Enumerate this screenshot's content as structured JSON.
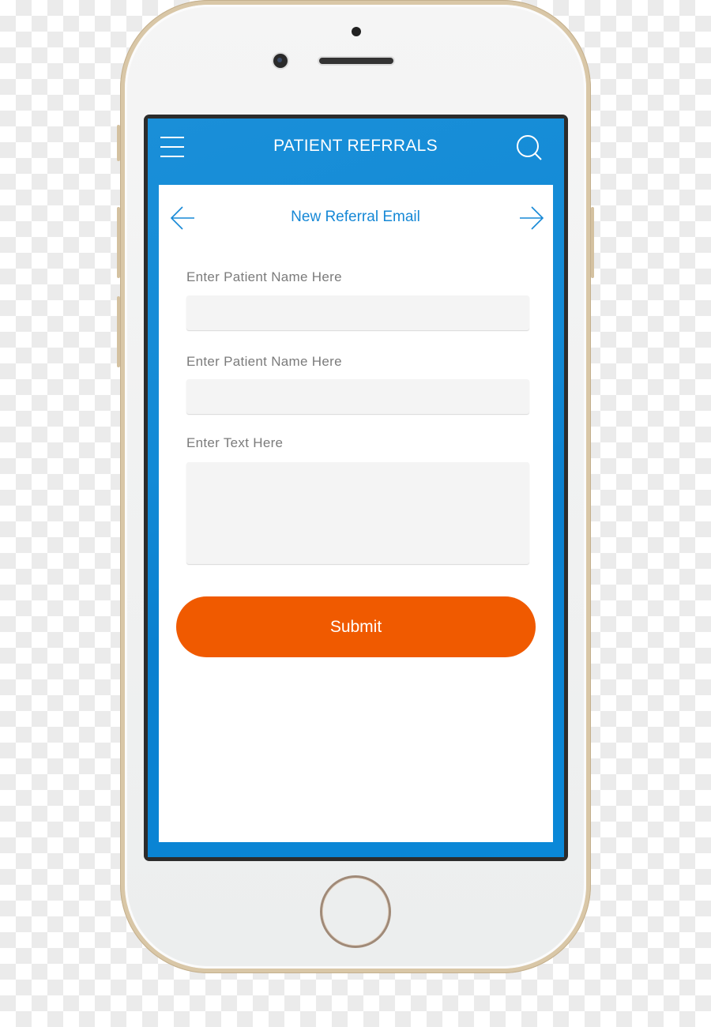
{
  "header": {
    "title": "PATIENT REFRRALS",
    "menu_icon": "hamburger-icon",
    "search_icon": "search-icon"
  },
  "subheader": {
    "title": "New Referral Email",
    "back_icon": "arrow-left-icon",
    "forward_icon": "arrow-right-icon"
  },
  "form": {
    "fields": [
      {
        "label": "Enter Patient Name Here",
        "value": ""
      },
      {
        "label": "Enter Patient Name Here",
        "value": ""
      },
      {
        "label": "Enter Text Here",
        "value": ""
      }
    ],
    "submit_label": "Submit"
  },
  "colors": {
    "header_blue": "#128ad6",
    "accent_blue": "#1688d6",
    "submit_orange": "#f05a00"
  }
}
